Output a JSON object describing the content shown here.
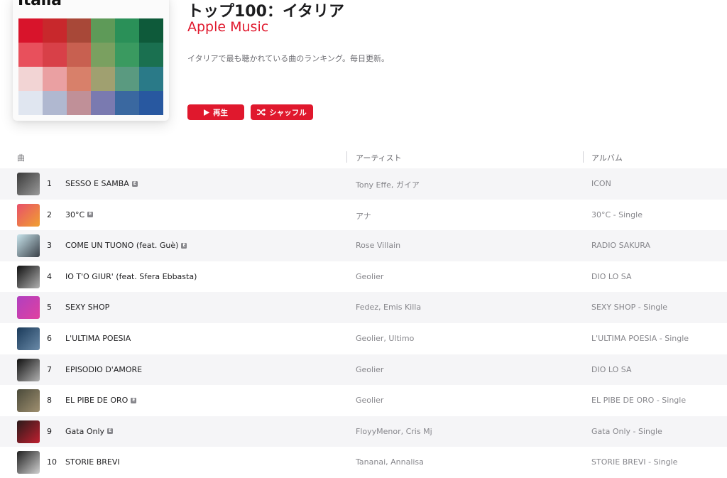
{
  "artwork": {
    "label": "Italia",
    "mosaic_colors": [
      "#d8142b",
      "#c8282c",
      "#a84838",
      "#5e9a58",
      "#2a9058",
      "#0e5a3a",
      "#e8505c",
      "#d84048",
      "#c86050",
      "#7aa060",
      "#3a9a60",
      "#1a7050",
      "#f2d4d4",
      "#eaa0a2",
      "#d8806a",
      "#a0a070",
      "#5a9a80",
      "#2a7a88",
      "#e0e6f0",
      "#b0b8d0",
      "#c09098",
      "#7a7ab0",
      "#3a68a0",
      "#2858a0"
    ]
  },
  "header": {
    "title": "トップ100：イタリア",
    "curator": "Apple Music",
    "description": "イタリアで最も聴かれている曲のランキング。毎日更新。",
    "play_label": "再生",
    "shuffle_label": "シャッフル",
    "play_icon": "play-icon",
    "shuffle_icon": "shuffle-icon"
  },
  "table": {
    "columns": [
      "曲",
      "アーティスト",
      "アルバム"
    ],
    "rows": [
      {
        "rank": "1",
        "title": "SESSO E SAMBA",
        "explicit": true,
        "artist": "Tony Effe, ガイア",
        "album": "ICON",
        "thumb": [
          "#3a3a3a",
          "#9a9a9a"
        ]
      },
      {
        "rank": "2",
        "title": "30°C",
        "explicit": true,
        "artist": "アナ",
        "album": "30°C - Single",
        "thumb": [
          "#e8506a",
          "#f0a030"
        ]
      },
      {
        "rank": "3",
        "title": "COME UN TUONO (feat. Guè)",
        "explicit": true,
        "artist": "Rose Villain",
        "album": "RADIO SAKURA",
        "thumb": [
          "#c8e4ec",
          "#3a4048"
        ]
      },
      {
        "rank": "4",
        "title": "IO T'O GIUR' (feat. Sfera Ebbasta)",
        "explicit": false,
        "artist": "Geolier",
        "album": "DIO LO SA",
        "thumb": [
          "#101010",
          "#b0b0b0"
        ]
      },
      {
        "rank": "5",
        "title": "SEXY SHOP",
        "explicit": false,
        "artist": "Fedez, Emis Killa",
        "album": "SEXY SHOP - Single",
        "thumb": [
          "#b040c0",
          "#e040a0"
        ]
      },
      {
        "rank": "6",
        "title": "L'ULTIMA POESIA",
        "explicit": false,
        "artist": "Geolier, Ultimo",
        "album": "L'ULTIMA POESIA - Single",
        "thumb": [
          "#1a3a5a",
          "#6a8aa8"
        ]
      },
      {
        "rank": "7",
        "title": "EPISODIO D'AMORE",
        "explicit": false,
        "artist": "Geolier",
        "album": "DIO LO SA",
        "thumb": [
          "#101010",
          "#b0b0b0"
        ]
      },
      {
        "rank": "8",
        "title": "EL PIBE DE ORO",
        "explicit": true,
        "artist": "Geolier",
        "album": "EL PIBE DE ORO - Single",
        "thumb": [
          "#4a4a3a",
          "#a09070"
        ]
      },
      {
        "rank": "9",
        "title": "Gata Only",
        "explicit": true,
        "artist": "FloyyMenor, Cris Mj",
        "album": "Gata Only - Single",
        "thumb": [
          "#2a1a1a",
          "#c02030"
        ]
      },
      {
        "rank": "10",
        "title": "STORIE BREVI",
        "explicit": false,
        "artist": "Tananai, Annalisa",
        "album": "STORIE BREVI - Single",
        "thumb": [
          "#202020",
          "#d0d0d0"
        ]
      }
    ]
  }
}
